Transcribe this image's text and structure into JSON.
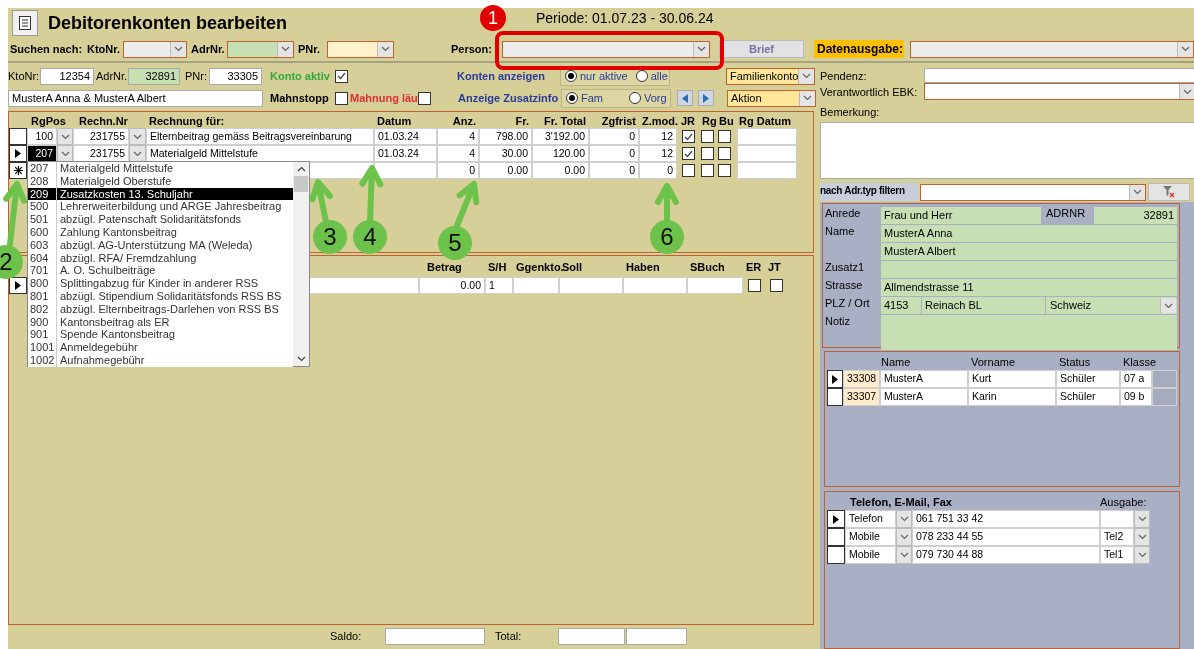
{
  "window": {
    "title": "Debitorenkonten bearbeiten",
    "period": "Periode: 01.07.23 - 30.06.24"
  },
  "search": {
    "label": "Suchen nach:",
    "fields": [
      {
        "label": "KtoNr.",
        "color": "#ececec"
      },
      {
        "label": "AdrNr.",
        "color": "#c6e0b4"
      },
      {
        "label": "PNr.",
        "color": "#fff2cc"
      }
    ],
    "person_label": "Person:",
    "letter_button": "Brief",
    "output_label": "Datenausgabe:"
  },
  "account": {
    "kto_label": "KtoNr:",
    "kto": "12354",
    "adr_label": "AdrNr.",
    "adr": "32891",
    "pnr_label": "PNr:",
    "pnr": "33305",
    "name": "MusterA Anna & MusterA Albert",
    "active_label": "Konto aktiv",
    "active": true,
    "stop_label": "Mahnstopp",
    "stop": false,
    "dunning_label": "Mahnung läu",
    "dunning": false,
    "type": "Familienkonto",
    "action": "Aktion"
  },
  "show_accounts": {
    "label": "Konten anzeigen",
    "options": [
      {
        "label": "nur aktive",
        "selected": true
      },
      {
        "label": "alle",
        "selected": false
      }
    ]
  },
  "show_info": {
    "label": "Anzeige Zusatzinfo",
    "options": [
      {
        "label": "Fam",
        "selected": true
      },
      {
        "label": "Vorg",
        "selected": false
      }
    ]
  },
  "invoices": {
    "columns": [
      "RgPos",
      "Rechn.Nr",
      "Rechnung für:",
      "Datum",
      "Anz.",
      "Fr.",
      "Fr. Total",
      "Zgfrist",
      "Z.mod.",
      "JR",
      "Rg",
      "Bu",
      "Rg Datum"
    ],
    "rows": [
      {
        "kind": "normal",
        "focused": false,
        "rgpos": "100",
        "number": "231755",
        "text": "Elternbeitrag gemäss Beitragsvereinbarung",
        "date": "01.03.24",
        "count": "4",
        "price": "798.00",
        "total": "3'192.00",
        "term": "0",
        "months": "12",
        "jr": true,
        "rg": false,
        "bu": false
      },
      {
        "kind": "current",
        "focused": true,
        "rgpos": "207",
        "number": "231755",
        "text": "Materialgeld Mittelstufe",
        "date": "01.03.24",
        "count": "4",
        "price": "30.00",
        "total": "120.00",
        "term": "0",
        "months": "12",
        "jr": true,
        "rg": false,
        "bu": false
      },
      {
        "kind": "new",
        "count": "0",
        "price": "0.00",
        "total": "0.00",
        "term": "0",
        "months": "0",
        "jr": false,
        "rg": false,
        "bu": false
      }
    ]
  },
  "dropdown": {
    "items": [
      {
        "code": "207",
        "text": "Materialgeld Mittelstufe",
        "selected": false
      },
      {
        "code": "208",
        "text": "Materialgeld Oberstufe",
        "selected": false
      },
      {
        "code": "209",
        "text": "Zusatzkosten 13. Schuljahr",
        "selected": true
      },
      {
        "code": "500",
        "text": "Lehrerweiterbildung und ARGE Jahresbeitrag",
        "selected": false
      },
      {
        "code": "501",
        "text": "abzügl. Patenschaft Solidaritätsfonds",
        "selected": false
      },
      {
        "code": "600",
        "text": "Zahlung Kantonsbeitrag",
        "selected": false
      },
      {
        "code": "603",
        "text": "abzügl. AG-Unterstützung MA (Weleda)",
        "selected": false
      },
      {
        "code": "604",
        "text": "abzügl. RFA/ Fremdzahlung",
        "selected": false
      },
      {
        "code": "701",
        "text": "A. O. Schulbeiträge",
        "selected": false
      },
      {
        "code": "800",
        "text": "Splittingabzug für Kinder in anderer RSS",
        "selected": false
      },
      {
        "code": "801",
        "text": "abzügl. Stipendium Solidaritätsfonds RSS BS",
        "selected": false
      },
      {
        "code": "802",
        "text": "abzügl. Elternbeitrags-Darlehen von RSS BS",
        "selected": false
      },
      {
        "code": "900",
        "text": "Kantonsbeitrag als ER",
        "selected": false
      },
      {
        "code": "901",
        "text": "Spende Kantonsbeitrag",
        "selected": false
      },
      {
        "code": "1001",
        "text": "Anmeldegebühr",
        "selected": false
      },
      {
        "code": "1002",
        "text": "Aufnahmegebühr",
        "selected": false
      }
    ]
  },
  "bookings": {
    "columns": [
      "Betrag",
      "S/H",
      "Ggenkto.",
      "Soll",
      "Haben",
      "SBuch",
      "ER",
      "JT"
    ],
    "row": {
      "amount": "0.00",
      "sh": "1",
      "er": false,
      "jt": false
    }
  },
  "totals": {
    "saldo_label": "Saldo:",
    "total_label": "Total:"
  },
  "notes": {
    "pending_label": "Pendenz:",
    "responsible_label": "Verantwortlich EBK:",
    "remark_label": "Bemerkung:"
  },
  "filter": {
    "label": "nach Adr.typ filtern"
  },
  "address": {
    "salutation_label": "Anrede",
    "salutation": "Frau und Herr",
    "adrnr_label": "ADRNR",
    "adrnr": "32891",
    "name_label": "Name",
    "name1": "MusterA Anna",
    "name2": "MusterA Albert",
    "extra_label": "Zusatz1",
    "street_label": "Strasse",
    "street": "Allmendstrasse 11",
    "city_label": "PLZ / Ort",
    "zip": "4153",
    "city": "Reinach BL",
    "country": "Schweiz",
    "note_label": "Notiz"
  },
  "children": {
    "columns": [
      "Name",
      "Vorname",
      "Status",
      "Klasse"
    ],
    "rows": [
      {
        "id": "33308",
        "name": "MusterA",
        "first": "Kurt",
        "status": "Schüler",
        "class": "07 a",
        "current": true
      },
      {
        "id": "33307",
        "name": "MusterA",
        "first": "Karin",
        "status": "Schüler",
        "class": "09 b",
        "current": false
      }
    ]
  },
  "contacts": {
    "title": "Telefon, E-Mail, Fax",
    "output_label": "Ausgabe:",
    "rows": [
      {
        "type": "Telefon",
        "value": "061 751 33 42",
        "current": true
      },
      {
        "type": "Mobile",
        "value": "078 233 44 55",
        "output": "Tel2",
        "current": false
      },
      {
        "type": "Mobile",
        "value": "079 730 44 88",
        "output": "Tel1",
        "current": false
      }
    ]
  },
  "annotations": [
    {
      "number": "1",
      "kind": "frame",
      "color": "#e00000"
    },
    {
      "number": "2",
      "kind": "arrow",
      "color": "#6cc24a"
    },
    {
      "number": "3",
      "kind": "arrow",
      "color": "#6cc24a"
    },
    {
      "number": "4",
      "kind": "arrow",
      "color": "#6cc24a"
    },
    {
      "number": "5",
      "kind": "arrow",
      "color": "#6cc24a"
    },
    {
      "number": "6",
      "kind": "arrow",
      "color": "#6cc24a"
    }
  ]
}
